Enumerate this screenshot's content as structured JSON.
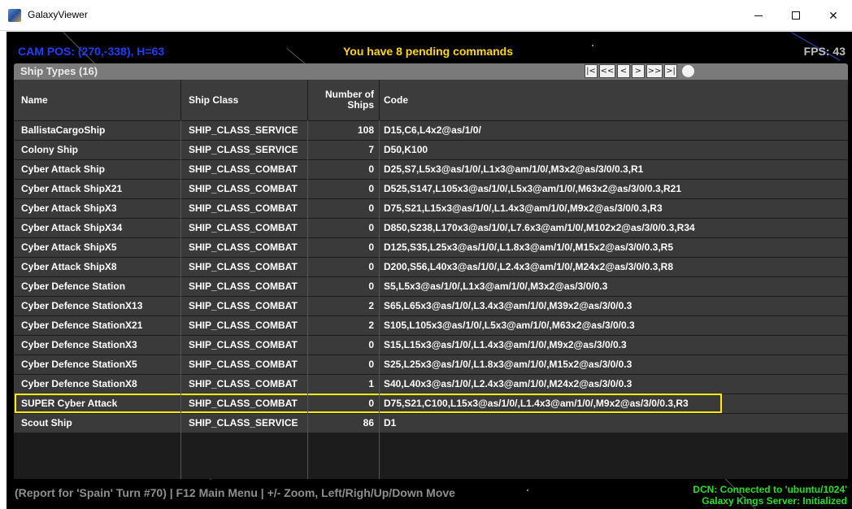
{
  "window": {
    "title": "GalaxyViewer",
    "minimize_glyph": "",
    "close_glyph": "✕"
  },
  "hud": {
    "cam_pos": "CAM POS: (270,-338), H=63",
    "pending": "You have 8 pending commands",
    "fps": "FPS: 43"
  },
  "panel": {
    "title": "Ship Types (16)",
    "pager": [
      "|<",
      "<<",
      "<",
      ">",
      ">>",
      ">|"
    ]
  },
  "table": {
    "headers": {
      "name": "Name",
      "ship_class": "Ship Class",
      "number_of_ships": "Number of Ships",
      "code": "Code"
    },
    "rows": [
      {
        "name": "BallistaCargoShip",
        "ship_class": "SHIP_CLASS_SERVICE",
        "count": "108",
        "code": "D15,C6,L4x2@as/1/0/"
      },
      {
        "name": "Colony Ship",
        "ship_class": "SHIP_CLASS_SERVICE",
        "count": "7",
        "code": "D50,K100"
      },
      {
        "name": "Cyber Attack Ship",
        "ship_class": "SHIP_CLASS_COMBAT",
        "count": "0",
        "code": "D25,S7,L5x3@as/1/0/,L1x3@am/1/0/,M3x2@as/3/0/0.3,R1"
      },
      {
        "name": "Cyber Attack ShipX21",
        "ship_class": "SHIP_CLASS_COMBAT",
        "count": "0",
        "code": "D525,S147,L105x3@as/1/0/,L5x3@am/1/0/,M63x2@as/3/0/0.3,R21"
      },
      {
        "name": "Cyber Attack ShipX3",
        "ship_class": "SHIP_CLASS_COMBAT",
        "count": "0",
        "code": "D75,S21,L15x3@as/1/0/,L1.4x3@am/1/0/,M9x2@as/3/0/0.3,R3"
      },
      {
        "name": "Cyber Attack ShipX34",
        "ship_class": "SHIP_CLASS_COMBAT",
        "count": "0",
        "code": "D850,S238,L170x3@as/1/0/,L7.6x3@am/1/0/,M102x2@as/3/0/0.3,R34"
      },
      {
        "name": "Cyber Attack ShipX5",
        "ship_class": "SHIP_CLASS_COMBAT",
        "count": "0",
        "code": "D125,S35,L25x3@as/1/0/,L1.8x3@am/1/0/,M15x2@as/3/0/0.3,R5"
      },
      {
        "name": "Cyber Attack ShipX8",
        "ship_class": "SHIP_CLASS_COMBAT",
        "count": "0",
        "code": "D200,S56,L40x3@as/1/0/,L2.4x3@am/1/0/,M24x2@as/3/0/0.3,R8"
      },
      {
        "name": "Cyber Defence Station",
        "ship_class": "SHIP_CLASS_COMBAT",
        "count": "0",
        "code": "S5,L5x3@as/1/0/,L1x3@am/1/0/,M3x2@as/3/0/0.3"
      },
      {
        "name": "Cyber Defence StationX13",
        "ship_class": "SHIP_CLASS_COMBAT",
        "count": "2",
        "code": "S65,L65x3@as/1/0/,L3.4x3@am/1/0/,M39x2@as/3/0/0.3"
      },
      {
        "name": "Cyber Defence StationX21",
        "ship_class": "SHIP_CLASS_COMBAT",
        "count": "2",
        "code": "S105,L105x3@as/1/0/,L5x3@am/1/0/,M63x2@as/3/0/0.3"
      },
      {
        "name": "Cyber Defence StationX3",
        "ship_class": "SHIP_CLASS_COMBAT",
        "count": "0",
        "code": "S15,L15x3@as/1/0/,L1.4x3@am/1/0/,M9x2@as/3/0/0.3"
      },
      {
        "name": "Cyber Defence StationX5",
        "ship_class": "SHIP_CLASS_COMBAT",
        "count": "0",
        "code": "S25,L25x3@as/1/0/,L1.8x3@am/1/0/,M15x2@as/3/0/0.3"
      },
      {
        "name": "Cyber Defence StationX8",
        "ship_class": "SHIP_CLASS_COMBAT",
        "count": "1",
        "code": "S40,L40x3@as/1/0/,L2.4x3@am/1/0/,M24x2@as/3/0/0.3"
      },
      {
        "name": "SUPER Cyber Attack",
        "ship_class": "SHIP_CLASS_COMBAT",
        "count": "0",
        "code": "D75,S21,C100,L15x3@as/1/0/,L1.4x3@am/1/0/,M9x2@as/3/0/0.3,R3",
        "selected": true
      },
      {
        "name": "Scout Ship",
        "ship_class": "SHIP_CLASS_SERVICE",
        "count": "86",
        "code": "D1"
      }
    ]
  },
  "footer": {
    "help": "(Report for 'Spain' Turn #70) | F12 Main Menu | +/- Zoom, Left/Righ/Up/Down Move",
    "connection": "DCN: Connected to 'ubuntu/1024'",
    "server": "Galaxy Kings Server: Initialized"
  },
  "colors": {
    "cam": "#1f3dff",
    "pending": "#ffd800",
    "selection": "#ffec00",
    "status": "#24e024"
  }
}
